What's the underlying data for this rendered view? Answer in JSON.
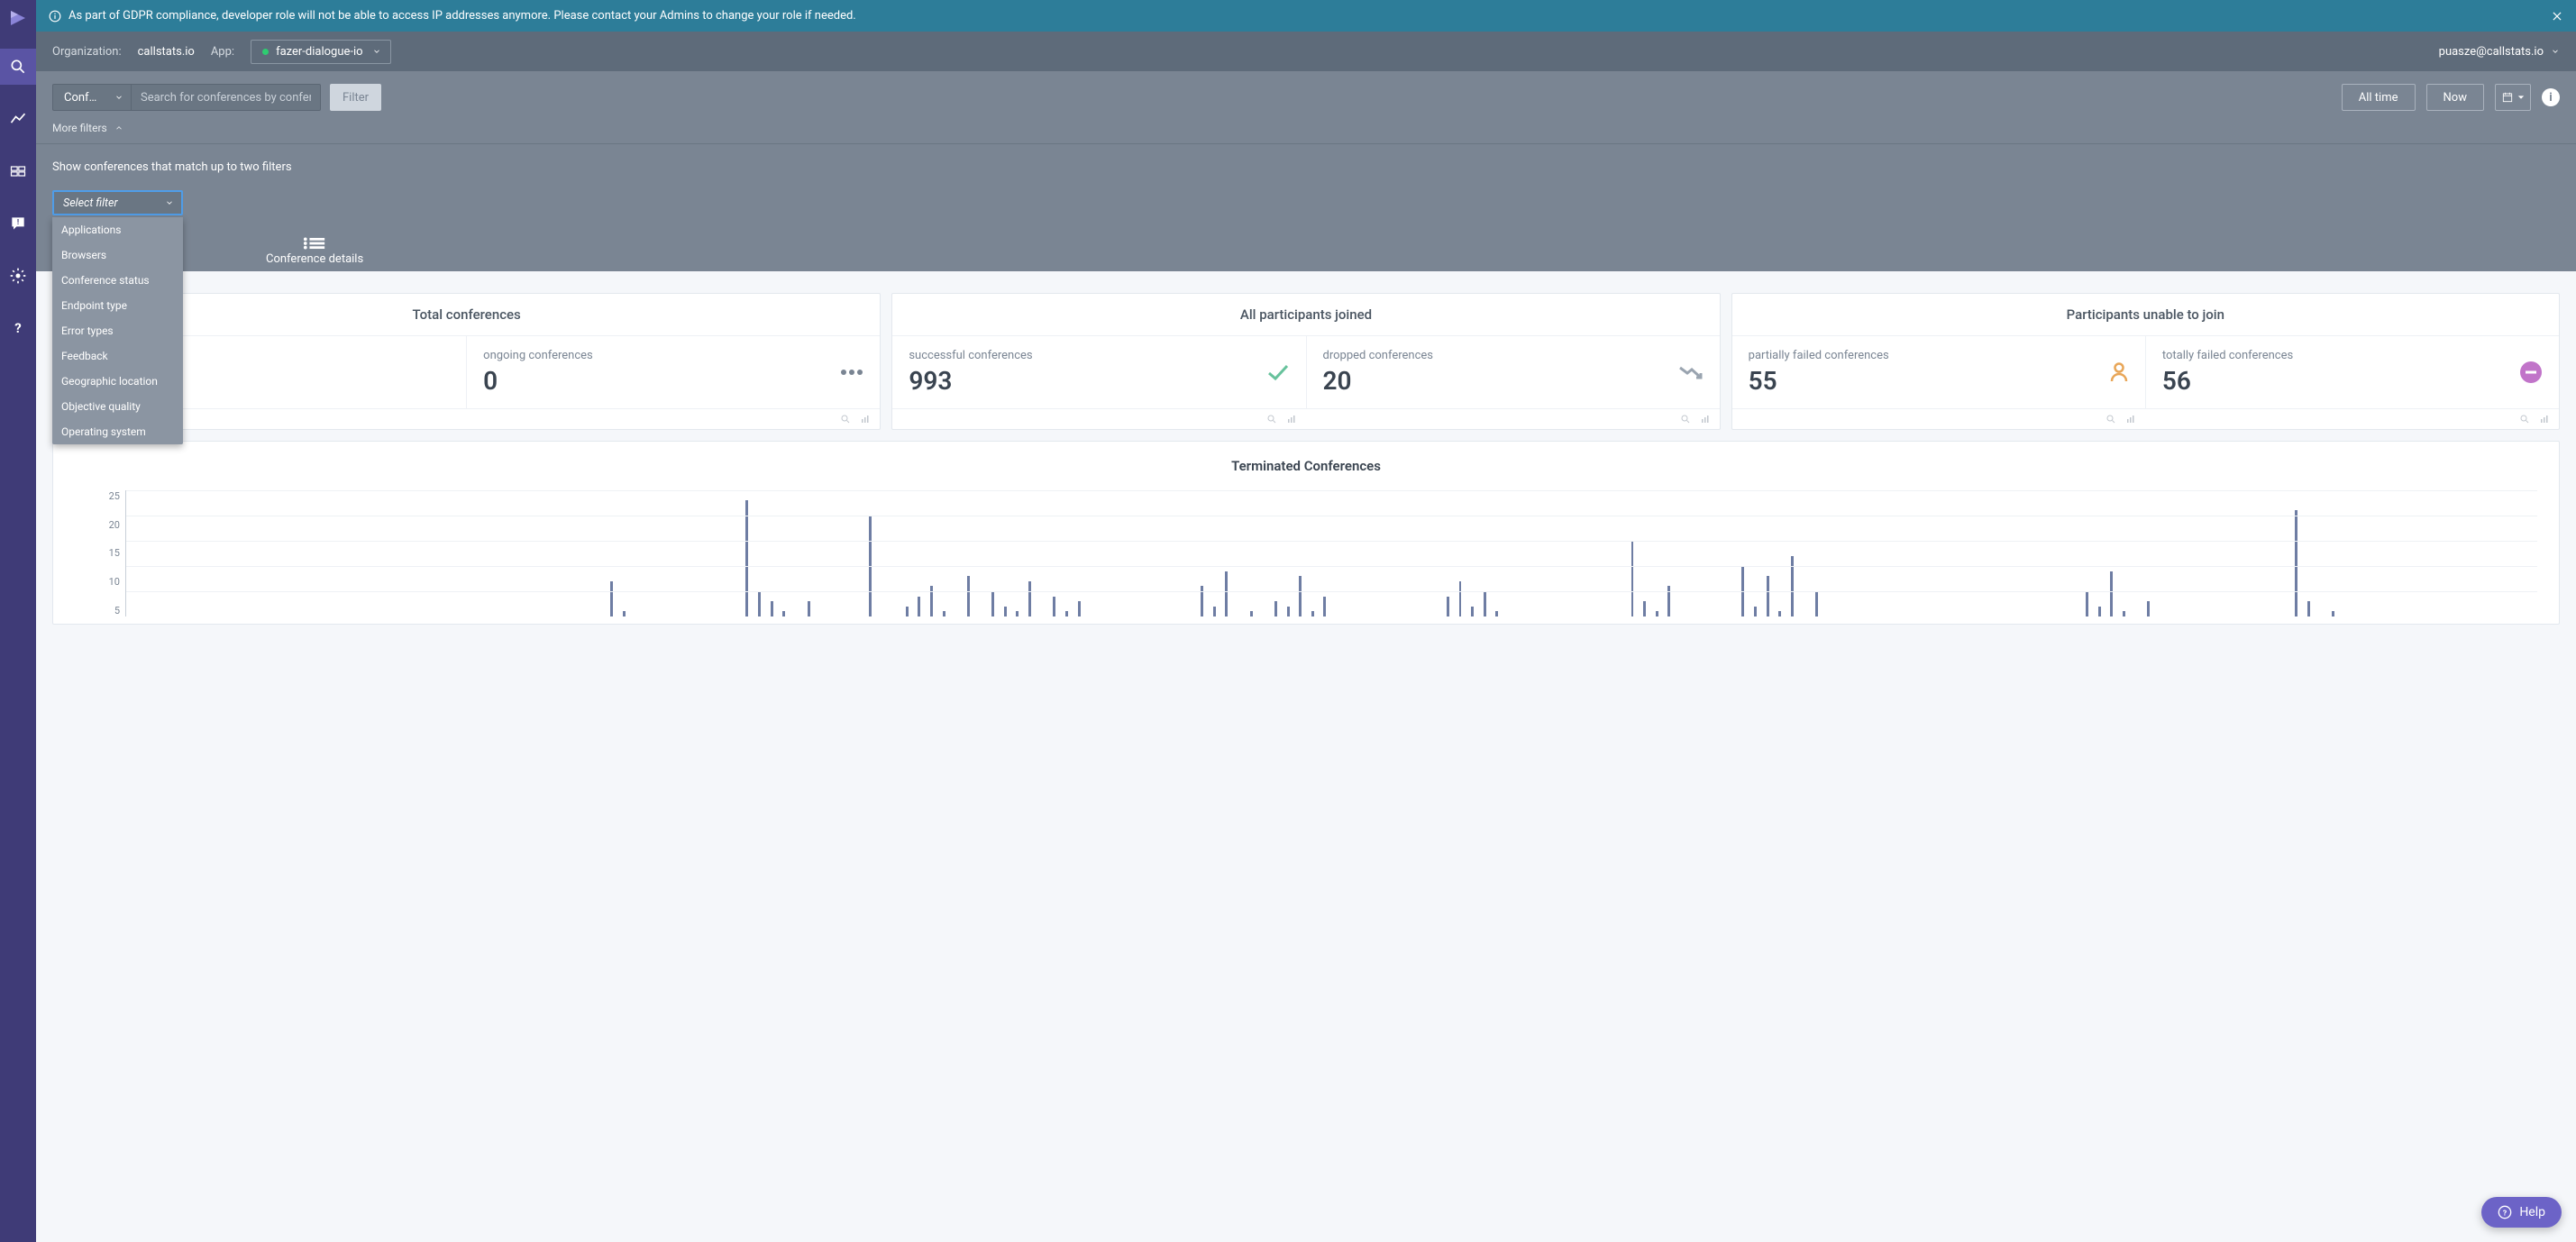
{
  "banner": {
    "text": "As part of GDPR compliance, developer role will not be able to access IP addresses anymore. Please contact your Admins to change your role if needed."
  },
  "topbar": {
    "org_label": "Organization:",
    "org_value": "callstats.io",
    "app_label": "App:",
    "app_value": "fazer-dialogue-io",
    "user_email": "puasze@callstats.io"
  },
  "filterbar": {
    "dropdown_label": "Conf…",
    "search_placeholder": "Search for conferences by conference id",
    "filter_btn": "Filter",
    "all_time": "All time",
    "now": "Now",
    "more_filters": "More filters"
  },
  "filter_expand": {
    "hint": "Show conferences that match up to two filters",
    "select_label": "Select filter",
    "options": [
      "Applications",
      "Browsers",
      "Conference status",
      "Endpoint type",
      "Error types",
      "Feedback",
      "Geographic location",
      "Objective quality",
      "Operating system"
    ]
  },
  "detail_tab": "Conference details",
  "cards": [
    {
      "title": "Total conferences",
      "cells": [
        {
          "label": "ongoing conferences",
          "value": "0",
          "icon": "dots"
        }
      ],
      "lead_icon": "people"
    },
    {
      "title": "All participants joined",
      "cells": [
        {
          "label": "successful conferences",
          "value": "993",
          "icon": "check"
        },
        {
          "label": "dropped conferences",
          "value": "20",
          "icon": "trend-down"
        }
      ]
    },
    {
      "title": "Participants unable to join",
      "cells": [
        {
          "label": "partially failed conferences",
          "value": "55",
          "icon": "person-outline"
        },
        {
          "label": "totally failed conferences",
          "value": "56",
          "icon": "minus"
        }
      ]
    }
  ],
  "chart_data": {
    "type": "bar",
    "title": "Terminated Conferences",
    "xlabel": "",
    "ylabel": "",
    "ylim": [
      0,
      25
    ],
    "yticks": [
      25,
      20,
      15,
      10,
      5
    ],
    "values": [
      0,
      0,
      0,
      0,
      0,
      0,
      0,
      0,
      0,
      0,
      0,
      0,
      0,
      0,
      0,
      0,
      0,
      0,
      0,
      0,
      0,
      0,
      0,
      0,
      0,
      0,
      0,
      0,
      0,
      0,
      0,
      0,
      0,
      0,
      0,
      0,
      0,
      0,
      0,
      7,
      1,
      0,
      0,
      0,
      0,
      0,
      0,
      0,
      0,
      0,
      23,
      5,
      3,
      1,
      0,
      3,
      0,
      0,
      0,
      0,
      20,
      0,
      0,
      2,
      4,
      6,
      1,
      0,
      8,
      0,
      5,
      2,
      1,
      7,
      0,
      4,
      1,
      3,
      0,
      0,
      0,
      0,
      0,
      0,
      0,
      0,
      0,
      6,
      2,
      9,
      0,
      1,
      0,
      3,
      2,
      8,
      1,
      4,
      0,
      0,
      0,
      0,
      0,
      0,
      0,
      0,
      0,
      4,
      7,
      2,
      5,
      1,
      0,
      0,
      0,
      0,
      0,
      0,
      0,
      0,
      0,
      0,
      15,
      3,
      1,
      6,
      0,
      0,
      0,
      0,
      0,
      10,
      2,
      8,
      1,
      12,
      0,
      5,
      0,
      0,
      0,
      0,
      0,
      0,
      0,
      0,
      0,
      0,
      0,
      0,
      0,
      0,
      0,
      0,
      0,
      0,
      0,
      0,
      0,
      5,
      2,
      9,
      1,
      0,
      3,
      0,
      0,
      0,
      0,
      0,
      0,
      0,
      0,
      0,
      0,
      0,
      21,
      3,
      0,
      1,
      0,
      0,
      0,
      0,
      0,
      0,
      0,
      0,
      0,
      0,
      0,
      0,
      0,
      0,
      0,
      0
    ]
  },
  "help": {
    "label": "Help"
  }
}
